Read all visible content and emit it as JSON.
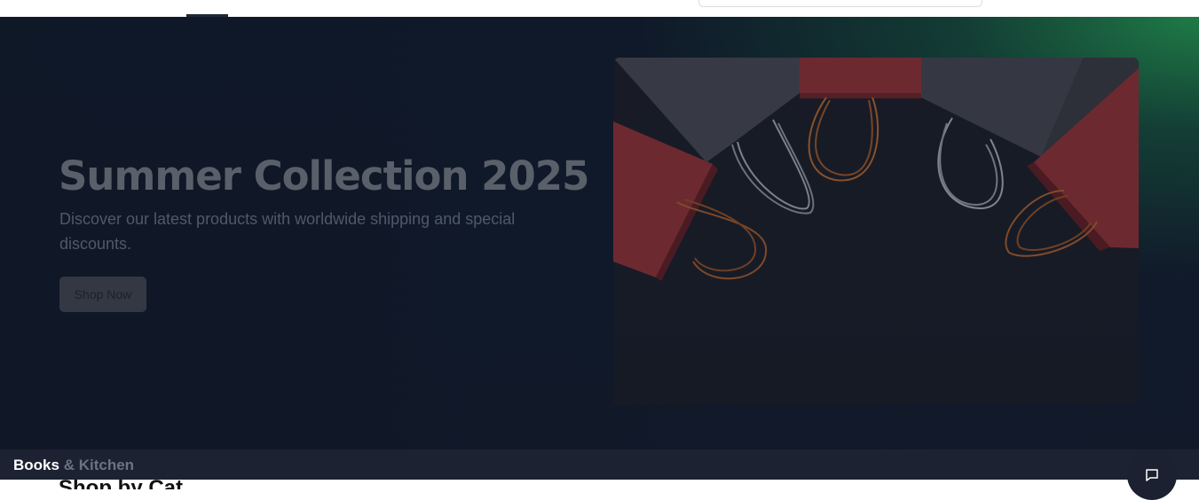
{
  "hero": {
    "title": "Summer Collection 2025",
    "subtitle": "Discover our latest products with worldwide shipping and special discounts.",
    "cta_label": "Shop Now",
    "image_alt": "shopping bags"
  },
  "category_bar": {
    "label_primary": "Books",
    "label_secondary": "& Kitchen"
  },
  "section": {
    "heading": "Shop by Cat"
  },
  "chat": {
    "icon": "chat-bubble-icon"
  },
  "colors": {
    "hero_bg": "#101a2b",
    "hero_accent": "#218c4c",
    "bag_red": "#8a2e33",
    "bag_gray": "#3a3c46"
  }
}
